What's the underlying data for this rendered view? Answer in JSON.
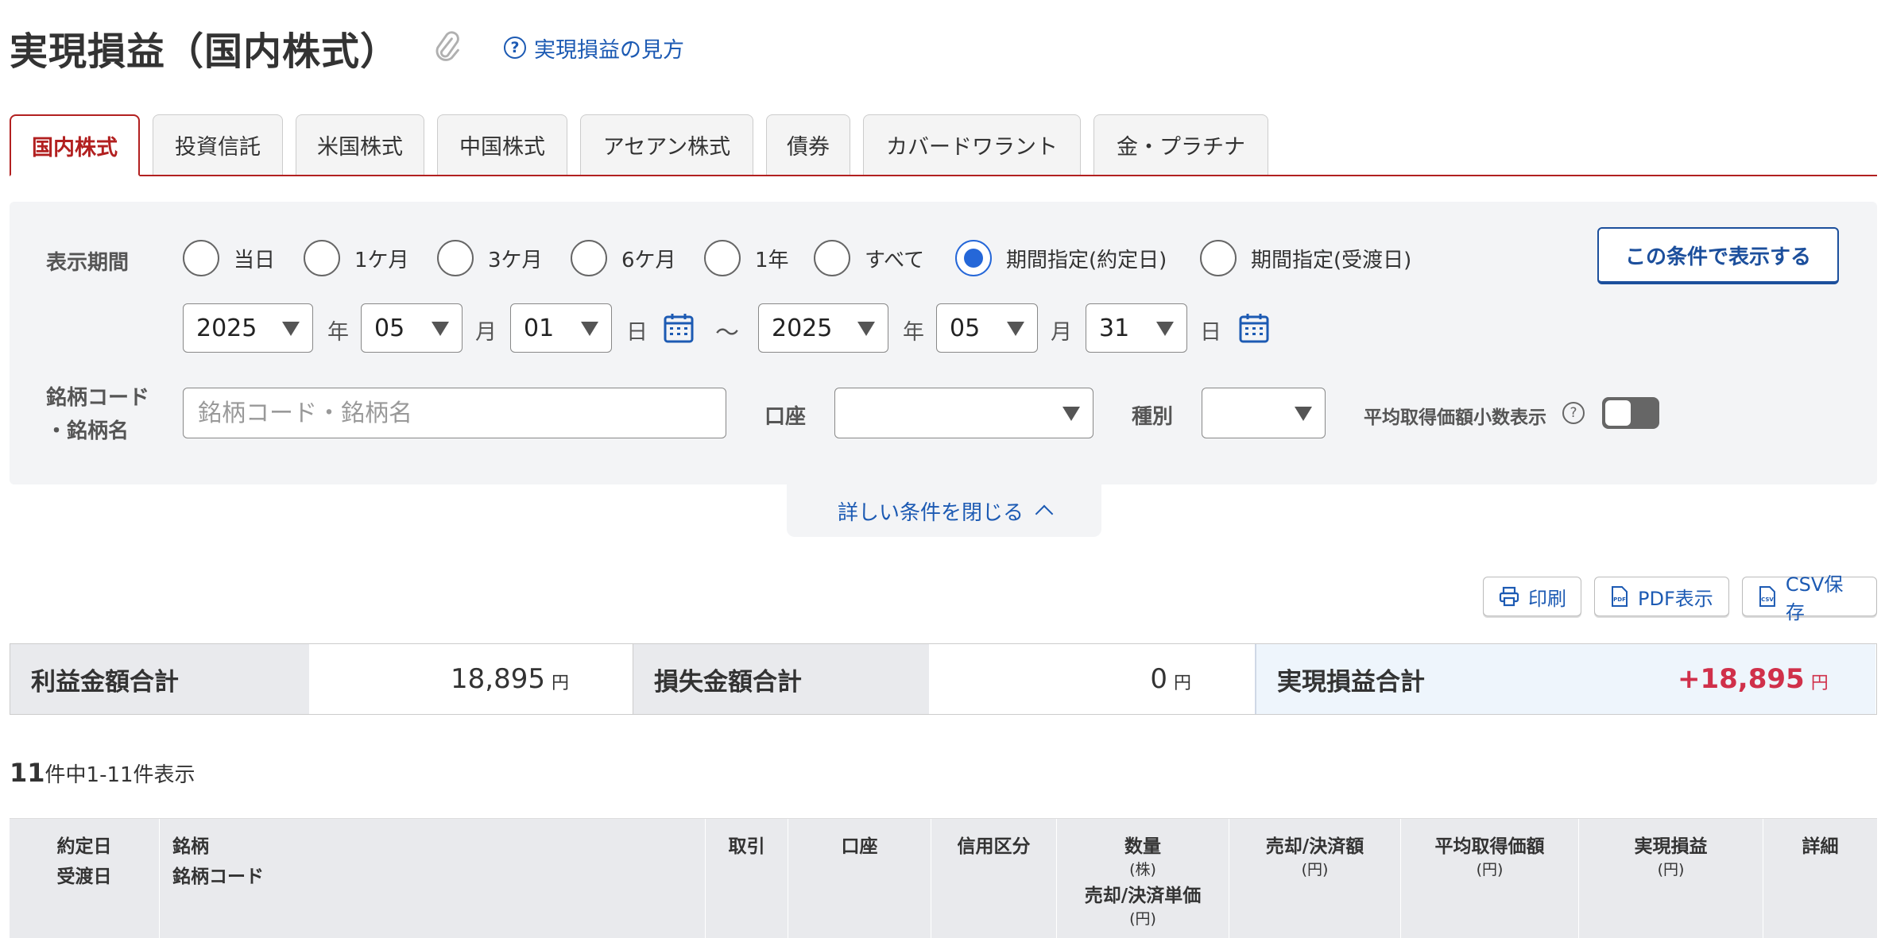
{
  "page": {
    "title": "実現損益（国内株式）",
    "help_link": "実現損益の見方",
    "help_mark": "?"
  },
  "tabs": [
    "国内株式",
    "投資信託",
    "米国株式",
    "中国株式",
    "アセアン株式",
    "債券",
    "カバードワラント",
    "金・プラチナ"
  ],
  "filter": {
    "period_label": "表示期間",
    "period_options": [
      "当日",
      "1ケ月",
      "3ケ月",
      "6ケ月",
      "1年",
      "すべて",
      "期間指定(約定日)",
      "期間指定(受渡日)"
    ],
    "selected_period": "期間指定(約定日)",
    "from": {
      "year": "2025",
      "month": "05",
      "day": "01"
    },
    "to": {
      "year": "2025",
      "month": "05",
      "day": "31"
    },
    "unit_year": "年",
    "unit_month": "月",
    "unit_day": "日",
    "range_sep": "〜",
    "submit_label": "この条件で表示する",
    "stock_label_line1": "銘柄コード",
    "stock_label_line2": "・銘柄名",
    "stock_placeholder": "銘柄コード・銘柄名",
    "account_label": "口座",
    "account_value": "",
    "type_label": "種別",
    "type_value": "",
    "avg_decimal_label": "平均取得価額小数表示",
    "avg_decimal_on": false,
    "close_label": "詳しい条件を閉じる"
  },
  "actions": {
    "print": "印刷",
    "pdf": "PDF表示",
    "csv": "CSV保存"
  },
  "summary": {
    "profit_label": "利益金額合計",
    "profit_value": "18,895",
    "loss_label": "損失金額合計",
    "loss_value": "0",
    "total_label": "実現損益合計",
    "total_value": "+18,895",
    "yen": "円"
  },
  "count": {
    "total": "11",
    "text": "件中1-11件表示"
  },
  "table": {
    "headers": {
      "date1": "約定日",
      "date2": "受渡日",
      "name1": "銘柄",
      "name2": "銘柄コード",
      "trade": "取引",
      "account": "口座",
      "margin": "信用区分",
      "qty": "数量",
      "qty_unit": "(株)",
      "unit_price": "売却/決済単価",
      "yen_unit": "(円)",
      "amount": "売却/決済額",
      "avg_cost": "平均取得価額",
      "pnl": "実現損益",
      "detail": "詳細"
    }
  },
  "colors": {
    "accent_red": "#b22020",
    "link_blue": "#1c5ab3",
    "radio_blue": "#2567d8",
    "profit_red": "#d0304a"
  }
}
